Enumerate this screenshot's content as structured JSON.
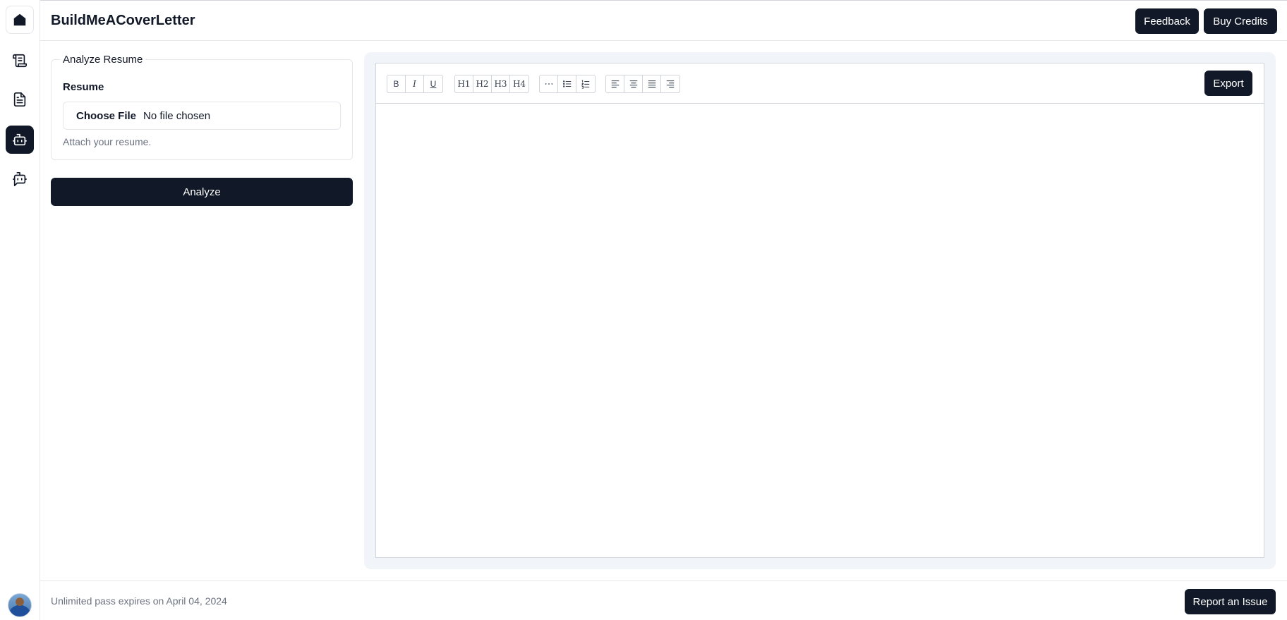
{
  "app": {
    "title": "BuildMeACoverLetter"
  },
  "header": {
    "feedback_label": "Feedback",
    "buy_credits_label": "Buy Credits"
  },
  "sidebar": {
    "items": [
      {
        "icon": "home-icon"
      },
      {
        "icon": "scroll-icon"
      },
      {
        "icon": "document-icon"
      },
      {
        "icon": "bot-icon",
        "active": true
      },
      {
        "icon": "bot-message-icon"
      }
    ]
  },
  "analyze_form": {
    "legend": "Analyze Resume",
    "field_label": "Resume",
    "file_button": "Choose File",
    "file_status": "No file chosen",
    "help_text": "Attach your resume.",
    "submit_label": "Analyze"
  },
  "editor": {
    "export_label": "Export",
    "toolbar": {
      "format": [
        "B",
        "I",
        "U"
      ],
      "headings": [
        "H1",
        "H2",
        "H3",
        "H4"
      ]
    }
  },
  "footer": {
    "pass_text": "Unlimited pass expires on April 04, 2024",
    "report_label": "Report an Issue"
  },
  "colors": {
    "primary": "#111827",
    "panel_bg": "#f1f5f9",
    "muted_text": "#6b7280"
  }
}
